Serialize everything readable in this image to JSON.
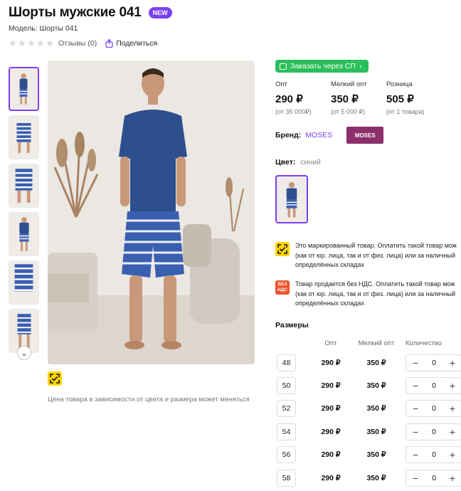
{
  "product": {
    "title": "Шорты мужские 041",
    "badge": "NEW",
    "model": "Модель: Шорты 041",
    "reviews": "Отзывы (0)",
    "share": "Поделиться",
    "price_note": "Цена товара в зависимости от цвета и размера может меняться"
  },
  "sp_button": "Заказать через СП",
  "prices": [
    {
      "label": "Опт",
      "value": "290 ₽",
      "sub": "(от 35 000₽)"
    },
    {
      "label": "Мелкий опт",
      "value": "350 ₽",
      "sub": "(от 5 000 ₽)"
    },
    {
      "label": "Розница",
      "value": "505 ₽",
      "sub": "(от 1 товара)"
    }
  ],
  "brand": {
    "label": "Бренд:",
    "value": "MOSES",
    "logo_text": "MOSES"
  },
  "color": {
    "label": "Цвет:",
    "value": "синий"
  },
  "notices": {
    "marked": {
      "line1": "Это маркированный товар. Оплатить такой товар мож",
      "line2": "(как от юр. лица, так и от физ. лица) или за наличный",
      "line3": "определённых складах"
    },
    "nds": {
      "icon": "БЕЗ НДС",
      "line1": "Товар продается без НДС. Оплатить такой товар мож",
      "line2": "(как от юр. лица, так и от физ. лица) или за наличный",
      "line3": "определённых складах"
    }
  },
  "sizes": {
    "title": "Размеры",
    "headers": {
      "opt": "Опт",
      "small": "Мелкий опт",
      "qty": "Количество"
    },
    "rows": [
      {
        "size": "48",
        "opt": "290 ₽",
        "small": "350 ₽",
        "qty": "0"
      },
      {
        "size": "50",
        "opt": "290 ₽",
        "small": "350 ₽",
        "qty": "0"
      },
      {
        "size": "52",
        "opt": "290 ₽",
        "small": "350 ₽",
        "qty": "0"
      },
      {
        "size": "54",
        "opt": "290 ₽",
        "small": "350 ₽",
        "qty": "0"
      },
      {
        "size": "56",
        "opt": "290 ₽",
        "small": "350 ₽",
        "qty": "0"
      },
      {
        "size": "58",
        "opt": "290 ₽",
        "small": "350 ₽",
        "qty": "0"
      }
    ],
    "minus": "−",
    "plus": "+"
  },
  "colors": {
    "accent": "#7b3ff2",
    "green": "#2bbf5b",
    "yellow": "#ffd500",
    "orange": "#f0522a",
    "brand": "#8c2f6b"
  }
}
